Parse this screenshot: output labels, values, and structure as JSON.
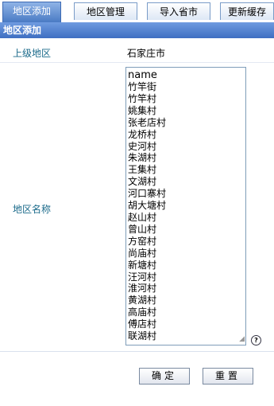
{
  "tabs": [
    {
      "label": "地区添加",
      "active": true
    },
    {
      "label": "地区管理",
      "active": false
    },
    {
      "label": "导入省市",
      "active": false
    },
    {
      "label": "更新缓存",
      "active": false
    }
  ],
  "section_title": "地区添加",
  "form": {
    "parent_label": "上级地区",
    "parent_value": "石家庄市",
    "name_label": "地区名称",
    "name_lines": [
      "name",
      "竹竿街",
      "竹竿村",
      "姚集村",
      "张老店村",
      "龙桥村",
      "史河村",
      "朱湖村",
      "王集村",
      "文湖村",
      "河口寨村",
      "胡大塘村",
      "赵山村",
      "曾山村",
      "方窑村",
      "尚庙村",
      "新塘村",
      "汪河村",
      "淮河村",
      "黄湖村",
      "高庙村",
      "傅店村",
      "联湖村"
    ],
    "help_icon": "?"
  },
  "buttons": {
    "confirm": "确定",
    "reset": "重置"
  },
  "colors": {
    "active_tab": "#4a7bc4",
    "title_bar": "#3e6fc2",
    "label_text": "#1a6a8a"
  }
}
